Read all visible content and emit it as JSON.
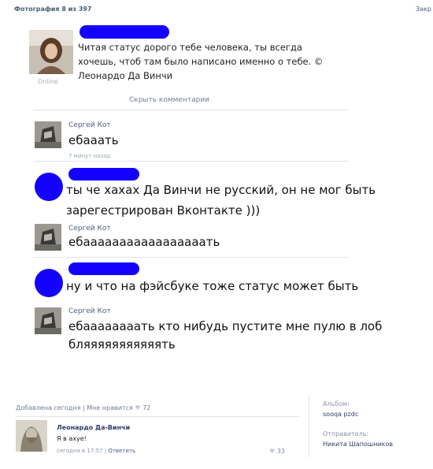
{
  "header": {
    "title": "Фотография 8 из 397",
    "close_label": "Закр"
  },
  "status": {
    "text_lines": [
      "Читая статус дорого тебе человека, ты всегда",
      "хочешь, чтоб там было написано именно о тебе. ©",
      "Леонардо Да Винчи"
    ],
    "online_label": "Online"
  },
  "hide_comments_label": "Скрыть комментарии",
  "comments": [
    {
      "author": "Сергей Кот",
      "lines": [
        "ебааать"
      ],
      "time": "7 минут назад"
    },
    {
      "author": "",
      "lines": [
        "ты че хахах Да Винчи не русский, он не мог быть",
        "зарегестрирован Вконтакте )))"
      ]
    },
    {
      "author": "Сергей Кот",
      "lines": [
        "ебааааааааааааааааать"
      ]
    },
    {
      "author": "",
      "lines": [
        "ну и что на фэйсбуке тоже статус может быть"
      ]
    },
    {
      "author": "Сергей Кот",
      "lines": [
        "ебаааааааать кто нибудь пустите мне пулю в лоб",
        "бляяяяяяяяяяять"
      ]
    }
  ],
  "footer": {
    "added": "Добавлена сегодня",
    "separator": "|",
    "like_label": "Мне нравится",
    "heart": "♥",
    "like_count": "72"
  },
  "sidebar": {
    "album_label": "Альбом:",
    "album_value": "sooqa pzdc",
    "sender_label": "Отправитель:",
    "sender_value": "Никита Шапошников"
  },
  "bottom_comment": {
    "author": "Леонардо Да-Винчи",
    "text": "Я в ахуе!",
    "time": "сегодня в 17:57",
    "separator": "|",
    "reply": "Ответить",
    "heart": "♥",
    "likes": "33"
  }
}
